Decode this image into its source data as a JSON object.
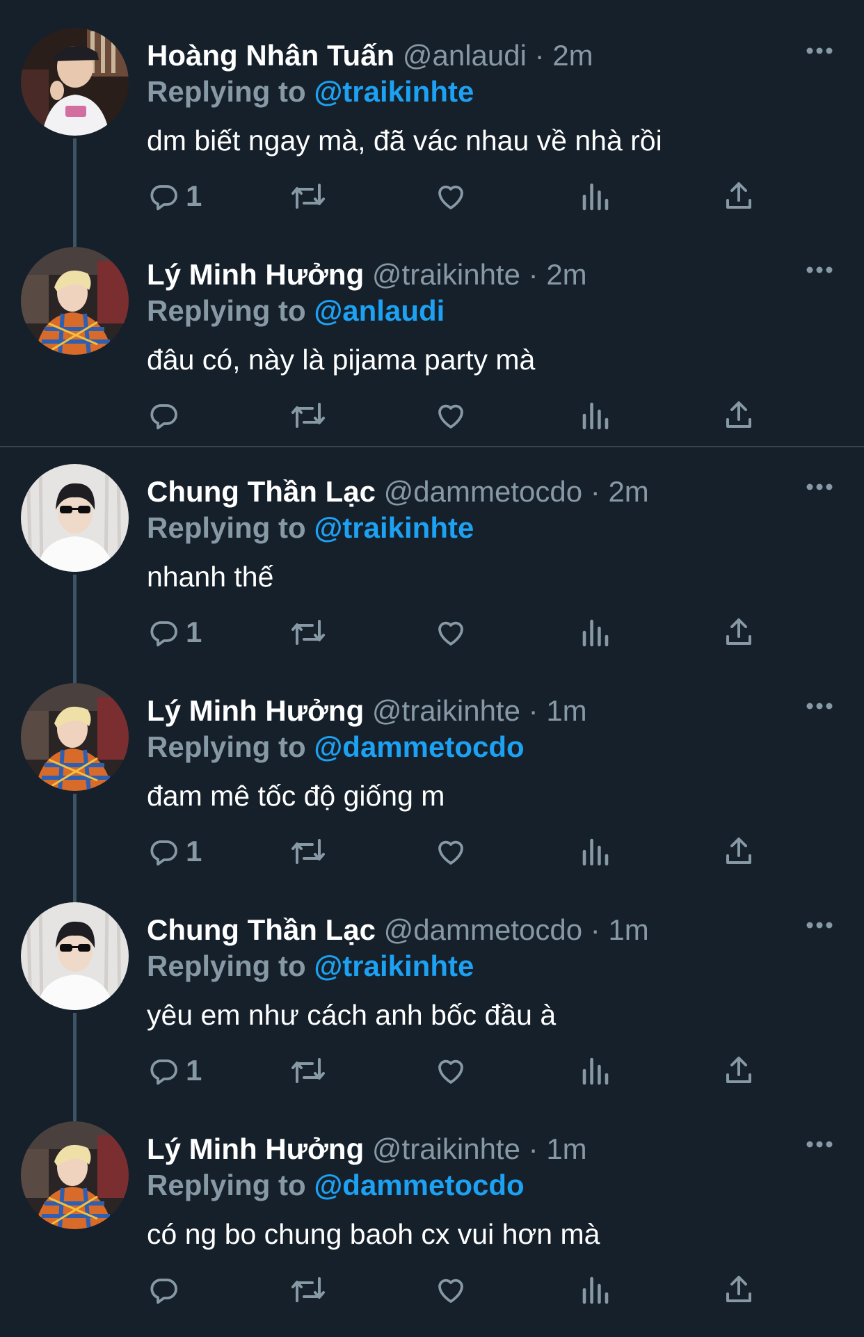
{
  "colors": {
    "background": "#15202b",
    "name": "#ffffff",
    "secondary": "#8899a6",
    "mention": "#1da1f2",
    "thread_line": "#3d5466",
    "divider": "#38444d"
  },
  "replying_label": "Replying to",
  "separator": "·",
  "tweets": [
    {
      "name": "Hoàng Nhân Tuấn",
      "handle": "@anlaudi",
      "time": "2m",
      "replying_to": "@traikinhte",
      "text": "dm biết ngay mà, đã vác nhau về nhà rồi",
      "reply_count": "1",
      "avatar_icon": "avatar-photo-white-cap"
    },
    {
      "name": "Lý Minh Hưởng",
      "handle": "@traikinhte",
      "time": "2m",
      "replying_to": "@anlaudi",
      "text": "đâu có, này là pijama party mà",
      "reply_count": "",
      "avatar_icon": "avatar-photo-blonde-plaid"
    },
    {
      "name": "Chung Thần Lạc",
      "handle": "@dammetocdo",
      "time": "2m",
      "replying_to": "@traikinhte",
      "text": "nhanh thế",
      "reply_count": "1",
      "avatar_icon": "avatar-photo-sunglasses"
    },
    {
      "name": "Lý Minh Hưởng",
      "handle": "@traikinhte",
      "time": "1m",
      "replying_to": "@dammetocdo",
      "text": "đam mê tốc độ giống m",
      "reply_count": "1",
      "avatar_icon": "avatar-photo-blonde-plaid"
    },
    {
      "name": "Chung Thần Lạc",
      "handle": "@dammetocdo",
      "time": "1m",
      "replying_to": "@traikinhte",
      "text": "yêu em như cách anh bốc đầu à",
      "reply_count": "1",
      "avatar_icon": "avatar-photo-sunglasses"
    },
    {
      "name": "Lý Minh Hưởng",
      "handle": "@traikinhte",
      "time": "1m",
      "replying_to": "@dammetocdo",
      "text": "có ng bo chung baoh cx vui hơn mà",
      "reply_count": "",
      "avatar_icon": "avatar-photo-blonde-plaid"
    }
  ]
}
